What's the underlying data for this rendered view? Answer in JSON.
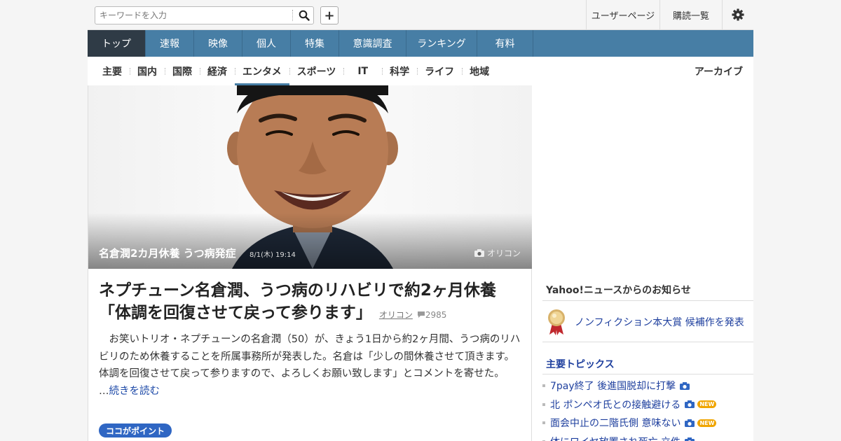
{
  "header": {
    "search_placeholder": "キーワードを入力",
    "plus_label": "+",
    "user_page": "ユーザーページ",
    "subscriptions": "購読一覧"
  },
  "nav": {
    "items": [
      {
        "label": "トップ",
        "active": true
      },
      {
        "label": "速報"
      },
      {
        "label": "映像"
      },
      {
        "label": "個人"
      },
      {
        "label": "特集"
      },
      {
        "label": "意識調査"
      },
      {
        "label": "ランキング"
      },
      {
        "label": "有料"
      }
    ]
  },
  "subnav": {
    "items": [
      "主要",
      "国内",
      "国際",
      "経済",
      "エンタメ",
      "スポーツ",
      "IT",
      "科学",
      "ライフ",
      "地域"
    ],
    "active_index": 4,
    "archive": "アーカイブ"
  },
  "hero": {
    "caption": "名倉潤2カ月休養 うつ病発症",
    "time": "8/1(木) 19:14",
    "source": "オリコン"
  },
  "article": {
    "title": "ネプチューン名倉潤、うつ病のリハビリで約2ヶ月休養「体調を回復させて戻って参ります」",
    "source": "オリコン",
    "comment_count": "2985",
    "body": "お笑いトリオ・ネプチューンの名倉潤（50）が、きょう1日から約2ヶ月間、うつ病のリハビリのため休養することを所属事務所が発表した。名倉は「少しの間休養させて頂きます。体調を回復させて戻って参りますので、よろしくお願い致します」とコメントを寄せた。",
    "more_prefix": "…",
    "more_link": "続きを読む",
    "point_badge": "ココがポイント"
  },
  "sidebar": {
    "notice_heading": "Yahoo!ニュースからのお知らせ",
    "notice_item": "ノンフィクション本大賞 候補作を発表",
    "topics_heading": "主要トピックス",
    "topics": [
      {
        "text": "7pay終了 後進国脱却に打撃",
        "photo": true,
        "new": false
      },
      {
        "text": "北 ポンペオ氏との接触避ける",
        "photo": true,
        "new": true
      },
      {
        "text": "面会中止の二階氏側 意味ない",
        "photo": true,
        "new": true
      },
      {
        "text": "体にワイヤ放置され死亡 立件",
        "photo": true,
        "new": false
      }
    ],
    "new_label": "NEW"
  },
  "colors": {
    "nav_bg": "#477ea5",
    "nav_active": "#2f3b46",
    "link": "#1e3f9e",
    "badge_blue": "#2f66c3",
    "new_badge": "#f0a500"
  }
}
